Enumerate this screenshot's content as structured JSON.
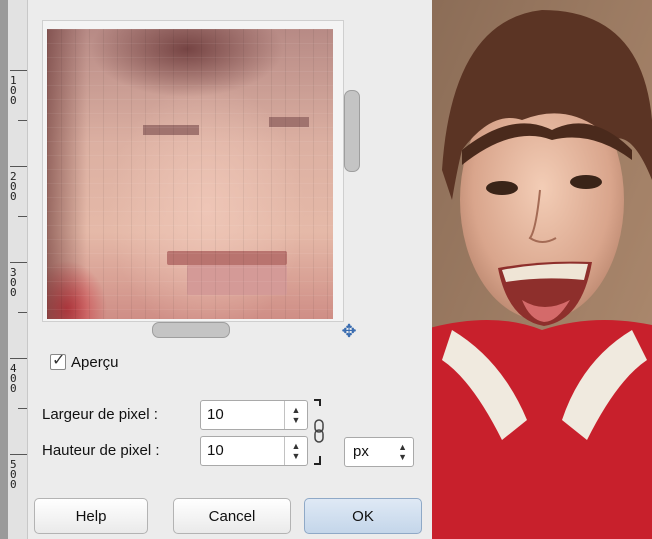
{
  "ruler": {
    "labels": [
      "1\n0\n0",
      "2\n0\n0",
      "3\n0\n0",
      "4\n0\n0",
      "5\n0\n0"
    ]
  },
  "preview": {
    "checkbox_label": "Aperçu",
    "checked": true
  },
  "fields": {
    "width_label": "Largeur de pixel :",
    "width_value": "10",
    "height_label": "Hauteur de pixel :",
    "height_value": "10",
    "unit_value": "px"
  },
  "buttons": {
    "help": "Help",
    "cancel": "Cancel",
    "ok": "OK"
  },
  "colors": {
    "accent": "#3b6db0",
    "shirt": "#c8202c"
  }
}
